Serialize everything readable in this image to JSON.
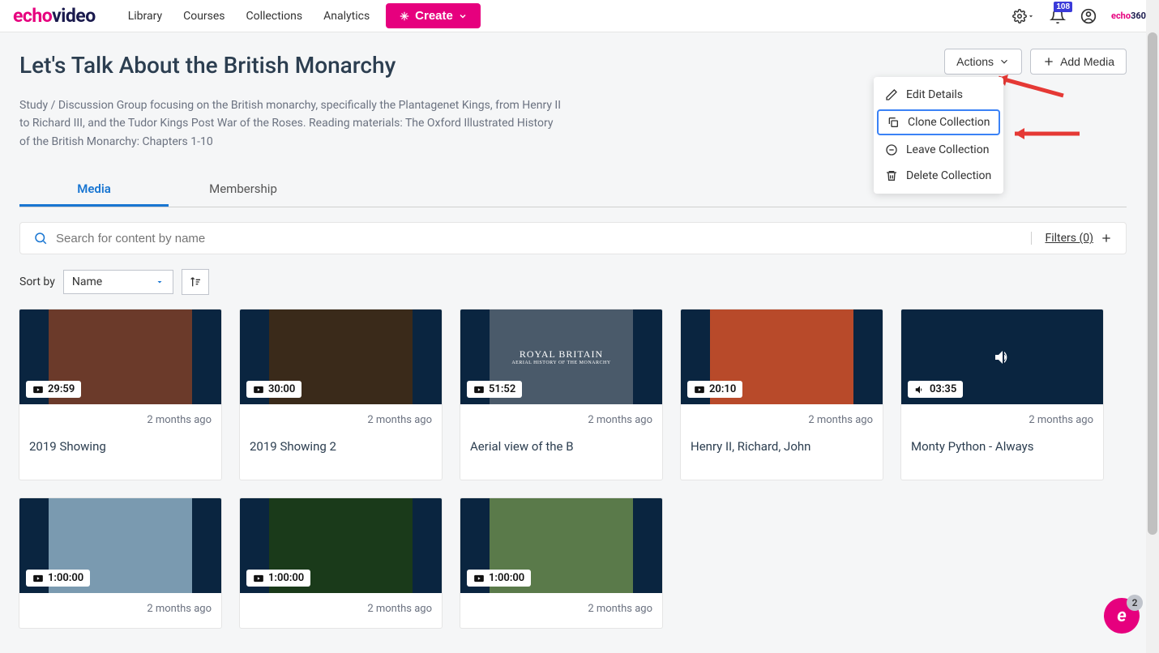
{
  "logo": {
    "part1": "echo",
    "part2": "video"
  },
  "nav": {
    "library": "Library",
    "courses": "Courses",
    "collections": "Collections",
    "analytics": "Analytics",
    "create": "Create"
  },
  "notif_count": "108",
  "mini_brand": {
    "p1": "echo",
    "p2": "360"
  },
  "page": {
    "title": "Let's Talk About the British Monarchy",
    "description": "Study / Discussion Group focusing on the British monarchy, specifically the Plantagenet Kings, from Henry II to Richard III, and the Tudor Kings Post War of the Roses. Reading materials: The Oxford Illustrated History of the British Monarchy: Chapters 1-10"
  },
  "actions": {
    "actions_label": "Actions",
    "add_media_label": "Add Media"
  },
  "dropdown": {
    "edit": "Edit Details",
    "clone": "Clone Collection",
    "leave": "Leave Collection",
    "delete": "Delete Collection"
  },
  "tabs": {
    "media": "Media",
    "membership": "Membership"
  },
  "search": {
    "placeholder": "Search for content by name"
  },
  "filters": {
    "label": "Filters (0)"
  },
  "sort": {
    "label": "Sort by",
    "value": "Name"
  },
  "cards": [
    {
      "duration": "29:59",
      "date": "2 months ago",
      "title": "2019 Showing",
      "kind": "video",
      "bg": "#6b3a2a"
    },
    {
      "duration": "30:00",
      "date": "2 months ago",
      "title": "2019 Showing 2",
      "kind": "video",
      "bg": "#3a2a1a"
    },
    {
      "duration": "51:52",
      "date": "2 months ago",
      "title": "Aerial view of the B",
      "kind": "video",
      "bg": "#4a5a6a",
      "overlay": "ROYAL BRITAIN"
    },
    {
      "duration": "20:10",
      "date": "2 months ago",
      "title": "Henry II, Richard, John",
      "kind": "video",
      "bg": "#b84a2a"
    },
    {
      "duration": "03:35",
      "date": "2 months ago",
      "title": "Monty Python - Always",
      "kind": "audio",
      "bg": "#0a2540"
    },
    {
      "duration": "1:00:00",
      "date": "2 months ago",
      "title": "",
      "kind": "video",
      "bg": "#7a9ab0"
    },
    {
      "duration": "1:00:00",
      "date": "2 months ago",
      "title": "",
      "kind": "video",
      "bg": "#1a3a1a"
    },
    {
      "duration": "1:00:00",
      "date": "2 months ago",
      "title": "",
      "kind": "video",
      "bg": "#5a7a4a"
    }
  ],
  "chat": {
    "letter": "e",
    "count": "2"
  }
}
